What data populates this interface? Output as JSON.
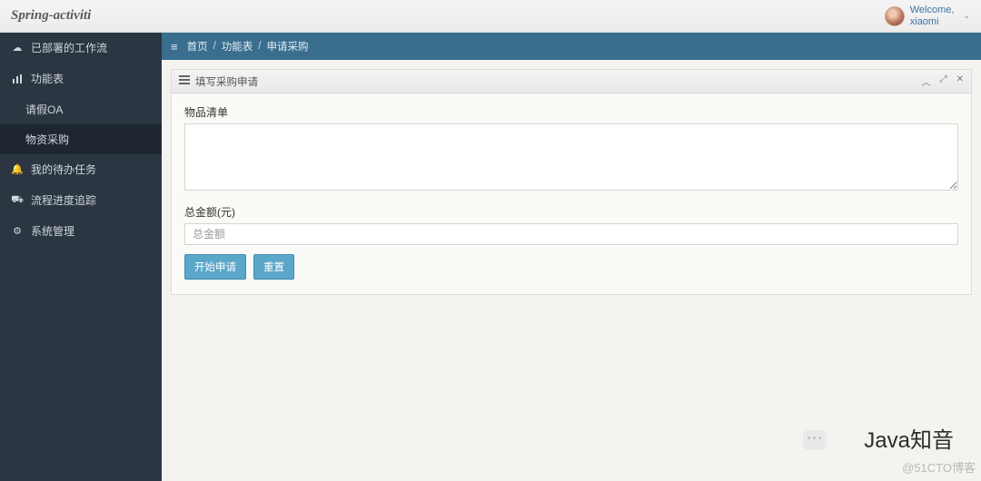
{
  "brand": "Spring-activiti",
  "user": {
    "welcome": "Welcome,",
    "name": "xiaomi"
  },
  "sidebar": {
    "items": [
      {
        "icon": "☁",
        "label": "已部署的工作流"
      },
      {
        "icon": "📊",
        "label": "功能表"
      },
      {
        "icon": "🔔",
        "label": "我的待办任务"
      },
      {
        "icon": "🚗",
        "label": "流程进度追踪"
      },
      {
        "icon": "⚙",
        "label": "系统管理"
      }
    ],
    "subs": [
      {
        "label": "请假OA"
      },
      {
        "label": "物资采购"
      }
    ]
  },
  "breadcrumb": {
    "home": "首页",
    "cat": "功能表",
    "page": "申请采购"
  },
  "panel": {
    "title": "填写采购申请",
    "field_items": "物品清单",
    "field_amount": "总金额(元)",
    "amount_placeholder": "总金额",
    "btn_submit": "开始申请",
    "btn_reset": "重置"
  },
  "watermark": {
    "main": "Java知音",
    "sub": "@51CTO博客"
  }
}
